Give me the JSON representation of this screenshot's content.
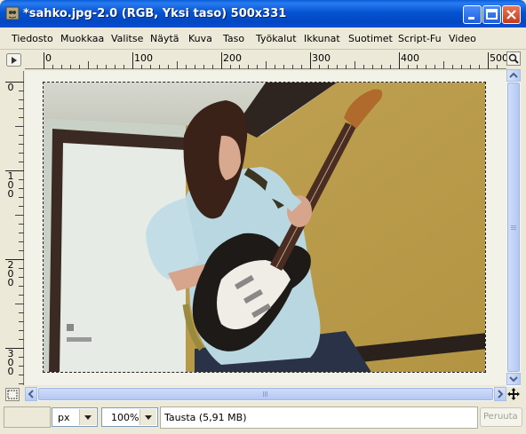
{
  "window": {
    "title": "*sahko.jpg-2.0 (RGB, Yksi taso) 500x331"
  },
  "menu": {
    "items": [
      "Tiedosto",
      "Muokkaa",
      "Valitse",
      "Näytä",
      "Kuva",
      "Taso",
      "Työkalut",
      "Ikkunat",
      "Suotimet",
      "Script-Fu",
      "Video"
    ]
  },
  "ruler": {
    "h_labels": [
      "0",
      "100",
      "200",
      "300",
      "400",
      "500"
    ],
    "v_labels": [
      "0",
      "1\n0\n0",
      "2\n0\n0",
      "3\n0\n0"
    ]
  },
  "statusbar": {
    "unit": "px",
    "zoom": "100%",
    "layer_info": "Tausta (5,91 MB)",
    "cancel_label": "Peruuta"
  },
  "colors": {
    "titlebar": "#0a5fd8",
    "wall": "#c9a84f",
    "door": "#e8ebe8",
    "frame": "#3b2a24"
  },
  "icons": {
    "app": "gimp-icon",
    "minimize": "minimize-icon",
    "maximize": "maximize-icon",
    "close": "close-icon",
    "menu_toggle": "menu-arrow-icon",
    "zoom": "zoom-icon",
    "quickmask": "quickmask-icon",
    "navigate": "navigate-icon"
  }
}
